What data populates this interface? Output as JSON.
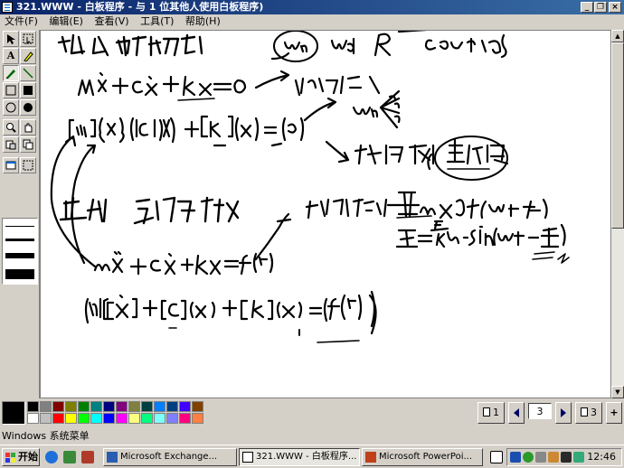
{
  "window": {
    "title": "321.WWW - 白板程序 - 与 1 位其他人使用白板程序)"
  },
  "menu": [
    "文件(F)",
    "编辑(E)",
    "查看(V)",
    "工具(T)",
    "帮助(H)"
  ],
  "tools": [
    "pointer-select",
    "area-select",
    "text-tool",
    "highlighter-tool",
    "pen-tool",
    "line-tool",
    "hollow-rect-tool",
    "filled-rect-tool",
    "hollow-ellipse-tool",
    "filled-ellipse-tool",
    "zoom-tool",
    "remote-pointer-tool",
    "lock-contents-tool",
    "synchronize-tool",
    "select-window-tool",
    "select-area-tool"
  ],
  "line_widths": [
    "thin",
    "medium",
    "thick",
    "heaviest"
  ],
  "palette": {
    "current": "#000000",
    "colors": [
      "#000000",
      "#808080",
      "#800000",
      "#808000",
      "#008000",
      "#008080",
      "#000080",
      "#800080",
      "#808040",
      "#004040",
      "#0080ff",
      "#004080",
      "#4000ff",
      "#804000",
      "#ffffff",
      "#c0c0c0",
      "#ff0000",
      "#ffff00",
      "#00ff00",
      "#00ffff",
      "#0000ff",
      "#ff00ff",
      "#ffff80",
      "#00ff80",
      "#80ffff",
      "#8080ff",
      "#ff0080",
      "#ff8040"
    ]
  },
  "page_nav": {
    "first_label": "1",
    "current": "3",
    "last_label": "3"
  },
  "sysmenu_label": "Windows 系统菜单",
  "taskbar": {
    "start_label": "开始",
    "tasks": [
      "Microsoft Exchange...",
      "321.WWW - 白板程序...",
      "Microsoft PowerPoi..."
    ],
    "clock": "12:46"
  }
}
